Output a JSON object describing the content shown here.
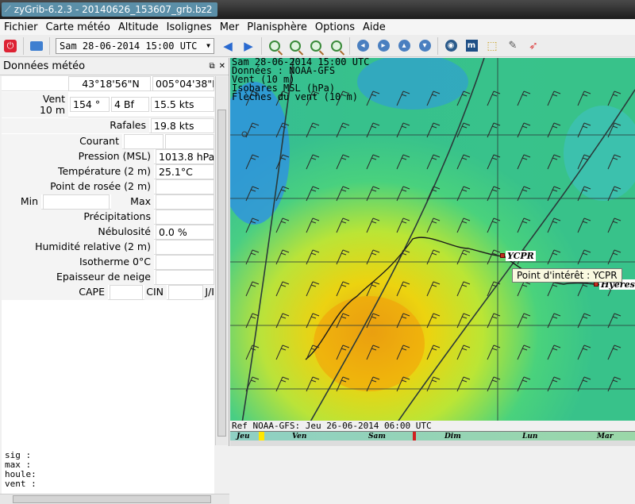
{
  "window": {
    "title": "zyGrib-6.2.3 - 20140626_153607_grb.bz2"
  },
  "menu": [
    "Fichier",
    "Carte météo",
    "Altitude",
    "Isolignes",
    "Mer",
    "Planisphère",
    "Options",
    "Aide"
  ],
  "toolbar": {
    "date_value": "Sam 28-06-2014 15:00 UTC",
    "icons": [
      "quit-icon",
      "open-folder-icon",
      "date-select",
      "prev-arrow-icon",
      "next-arrow-icon",
      "zoom-in-icon",
      "zoom-out-icon",
      "zoom-fit-icon",
      "zoom-all-icon",
      "pan-left-icon",
      "pan-right-icon",
      "pan-up-icon",
      "pan-down-icon",
      "globe-icon",
      "meteotable-icon",
      "select-tool-icon",
      "rocket-icon"
    ]
  },
  "panel": {
    "title": "Données météo",
    "latitude": "43°18'56\"N",
    "longitude": "005°04'38\"E",
    "vent_label_1": "Vent",
    "vent_label_2": "10 m",
    "vent_dir": "154 °",
    "vent_bf": "4 Bf",
    "vent_kts": "15.5  kts",
    "rafales_label": "Rafales",
    "rafales_val": "19.8  kts",
    "courant_label": "Courant",
    "pression_label": "Pression (MSL)",
    "pression_val": "1013.8 hPa",
    "temp_label": "Température (2 m)",
    "temp_val": "25.1°C",
    "rosee_label": "Point de rosée (2 m)",
    "min_label": "Min",
    "max_label": "Max",
    "precip_label": "Précipitations",
    "nebul_label": "Nébulosité",
    "nebul_val": "0.0 %",
    "humid_label": "Humidité relative (2 m)",
    "iso_label": "Isotherme 0°C",
    "neige_label": "Epaisseur de neige",
    "cape_label": "CAPE",
    "cin_label": "CIN",
    "jl_label": "J/I"
  },
  "console": {
    "lines": [
      "sig  :",
      "max  :",
      "houle:",
      "vent :"
    ]
  },
  "map": {
    "info_lines": [
      "Sam 28-06-2014 15:00 UTC",
      "Données : NOAA-GFS",
      "Vent (10 m)",
      "Isobares MSL (hPa)",
      "Flèches du vent (10 m)"
    ],
    "poi_1": "YCPR",
    "poi_2": "Hyeres",
    "tooltip": "Point d'intérêt : YCPR",
    "ref": "Ref NOAA-GFS: Jeu 26-06-2014 06:00 UTC"
  },
  "timeline": {
    "days": [
      "Jeu",
      "Ven",
      "Sam",
      "Dim",
      "Lun",
      "Mar"
    ]
  }
}
